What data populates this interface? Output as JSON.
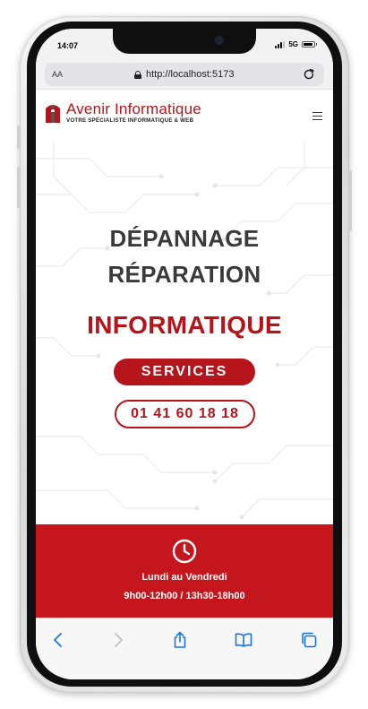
{
  "status_bar": {
    "time": "14:07",
    "network": "5G",
    "battery_level": 0.9
  },
  "browser": {
    "text_size_label": "AA",
    "url": "http://localhost:5173"
  },
  "site": {
    "brand": "Avenir Informatique",
    "tagline": "VOTRE SPÉCIALISTE INFORMATIQUE & WEB"
  },
  "hero": {
    "line1": "DÉPANNAGE",
    "line2": "RÉPARATION",
    "accent": "INFORMATIQUE",
    "services_label": "SERVICES",
    "phone_label": "01 41 60 18 18"
  },
  "hours": {
    "days": "Lundi au Vendredi",
    "time": "9h00-12h00 / 13h30-18h00"
  },
  "icons": {
    "clock": "clock-icon",
    "menu": "hamburger-menu-icon",
    "back": "chevron-left-icon",
    "forward": "chevron-right-icon",
    "share": "share-icon",
    "bookmarks": "book-icon",
    "tabs": "tabs-icon"
  },
  "colors": {
    "brand_red": "#b4141a",
    "band_red": "#c4161c",
    "title_gray": "#3a3a3a",
    "ios_blue": "#1a73e8"
  }
}
